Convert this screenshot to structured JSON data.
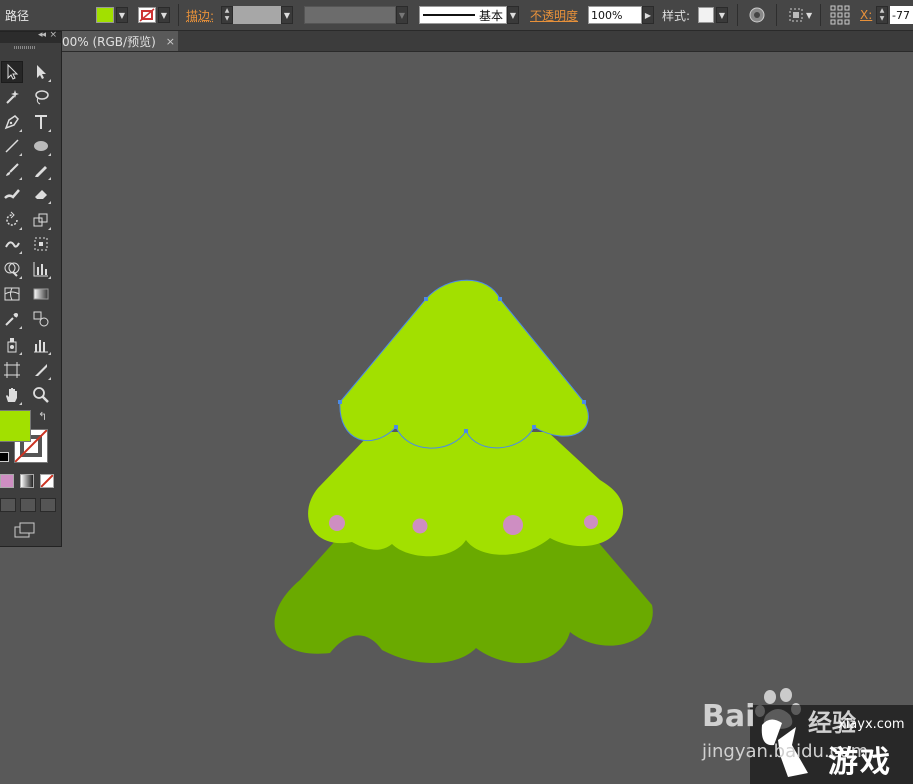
{
  "control_bar": {
    "object_type": "路径",
    "fill_color": "#A2E000",
    "stroke_label": "描边:",
    "stroke_style_label": "基本",
    "opacity_label": "不透明度",
    "opacity_value": "100%",
    "style_label": "样式:",
    "x_label": "X:",
    "x_value": "-77"
  },
  "document_tab": {
    "title": "00% (RGB/预览)",
    "close": "×"
  },
  "tools_panel": {
    "collapse_glyph": "◂◂",
    "close_glyph": "×",
    "fill_swatch_color": "#A2E000",
    "tools": [
      "selection-tool",
      "direct-selection-tool",
      "magic-wand-tool",
      "lasso-tool",
      "pen-tool",
      "type-tool",
      "line-tool",
      "ellipse-tool",
      "paintbrush-tool",
      "pencil-tool",
      "blob-brush-tool",
      "eraser-tool",
      "rotate-tool",
      "scale-tool",
      "warp-tool",
      "free-transform-tool",
      "shape-builder-tool",
      "graph-tool",
      "mesh-tool",
      "gradient-tool",
      "eyedropper-tool",
      "blend-tool",
      "symbol-sprayer-tool",
      "column-graph-tool",
      "artboard-tool",
      "slice-tool",
      "hand-tool",
      "zoom-tool"
    ]
  },
  "artwork": {
    "top_tier_color": "#A2E000",
    "bottom_tier_color": "#6AAA00",
    "ornament_color": "#CE8EC2",
    "selection_color": "#4B8BE8"
  },
  "watermark": {
    "baidu_text": "Bai",
    "baidu_suffix": "经验",
    "jingyan_text": "jingyan.baidu.com",
    "site_text": "xiayx.com",
    "brand_text": "游戏"
  }
}
